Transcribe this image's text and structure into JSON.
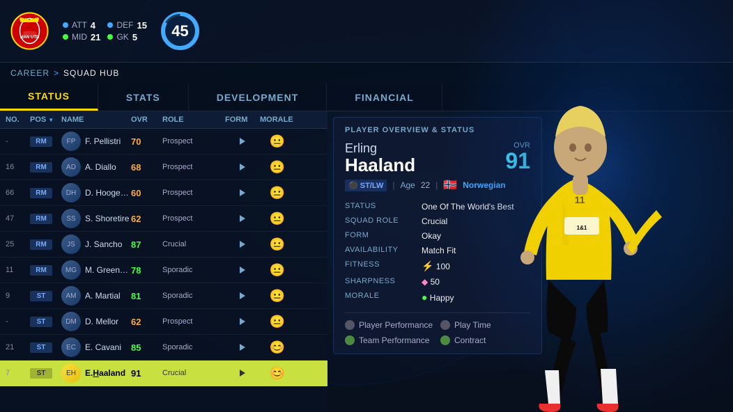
{
  "background": {
    "color": "#0a1628"
  },
  "topbar": {
    "stats": [
      {
        "key": "ATT",
        "val": "4",
        "color": "blue"
      },
      {
        "key": "DEF",
        "val": "15",
        "color": "blue"
      },
      {
        "key": "MID",
        "val": "21",
        "color": "green"
      },
      {
        "key": "GK",
        "val": "5",
        "color": "green"
      }
    ],
    "overall": "45"
  },
  "breadcrumb": {
    "career": "CAREER",
    "sep": ">",
    "current": "SQUAD HUB"
  },
  "nav": {
    "tabs": [
      {
        "label": "STATUS",
        "active": true
      },
      {
        "label": "STATS",
        "active": false
      },
      {
        "label": "DEVELOPMENT",
        "active": false
      },
      {
        "label": "FINANCIAL",
        "active": false
      }
    ]
  },
  "table": {
    "headers": [
      "No.",
      "Pos",
      "Name",
      "OVR",
      "Role",
      "Form",
      "Morale"
    ],
    "rows": [
      {
        "no": "-",
        "pos": "RM",
        "name": "F. Pellistri",
        "ovr": "70",
        "ovr_color": "orange",
        "role": "Prospect",
        "highlighted": false,
        "special": true,
        "morale": "neutral"
      },
      {
        "no": "16",
        "pos": "RM",
        "name": "A. Diallo",
        "ovr": "68",
        "ovr_color": "orange",
        "role": "Prospect",
        "highlighted": false,
        "special": false,
        "morale": "neutral"
      },
      {
        "no": "66",
        "pos": "RM",
        "name": "D. Hoogewerf",
        "ovr": "60",
        "ovr_color": "orange",
        "role": "Prospect",
        "highlighted": false,
        "special": false,
        "morale": "neutral"
      },
      {
        "no": "47",
        "pos": "RM",
        "name": "S. Shoretire",
        "ovr": "62",
        "ovr_color": "orange",
        "role": "Prospect",
        "highlighted": false,
        "special": false,
        "morale": "neutral"
      },
      {
        "no": "25",
        "pos": "RM",
        "name": "J. Sancho",
        "ovr": "87",
        "ovr_color": "green",
        "role": "Crucial",
        "highlighted": false,
        "special": false,
        "morale": "neutral"
      },
      {
        "no": "11",
        "pos": "RM",
        "name": "M. Greenwood",
        "ovr": "78",
        "ovr_color": "green",
        "role": "Sporadic",
        "highlighted": false,
        "special": false,
        "morale": "neutral"
      },
      {
        "no": "9",
        "pos": "ST",
        "name": "A. Martial",
        "ovr": "81",
        "ovr_color": "green",
        "role": "Sporadic",
        "highlighted": false,
        "special": false,
        "morale": "neutral"
      },
      {
        "no": "-",
        "pos": "ST",
        "name": "D. Mellor",
        "ovr": "62",
        "ovr_color": "orange",
        "role": "Prospect",
        "highlighted": false,
        "special": true,
        "morale": "neutral"
      },
      {
        "no": "21",
        "pos": "ST",
        "name": "E. Cavani",
        "ovr": "85",
        "ovr_color": "green",
        "role": "Sporadic",
        "highlighted": false,
        "special": false,
        "morale": "happy"
      },
      {
        "no": "7",
        "pos": "ST",
        "name": "E.Haaland",
        "ovr": "91",
        "ovr_color": "teal",
        "role": "Crucial",
        "highlighted": true,
        "special": false,
        "morale": "happy",
        "name_highlight": "H"
      }
    ]
  },
  "overview": {
    "panel_title": "PLAYER OVERVIEW & STATUS",
    "first_name": "Erling",
    "last_name": "Haaland",
    "ovr_label": "OVR",
    "ovr_value": "91",
    "meta": {
      "position": "ST/LW",
      "age_label": "Age",
      "age": "22",
      "nationality": "Norwegian",
      "flag": "🇳🇴"
    },
    "stats": [
      {
        "key": "STATUS",
        "val": "One Of The World's Best"
      },
      {
        "key": "SQUAD ROLE",
        "val": "Crucial"
      },
      {
        "key": "FORM",
        "val": "Okay"
      },
      {
        "key": "AVAILABILITY",
        "val": "Match Fit"
      },
      {
        "key": "FITNESS",
        "val": "⚡ 100",
        "icon": "lightning"
      },
      {
        "key": "SHARPNESS",
        "val": "💎 50",
        "icon": "diamond"
      },
      {
        "key": "MORALE",
        "val": "🟢 Happy",
        "icon": "circle"
      }
    ],
    "footer": [
      {
        "label": "Player Performance",
        "green": false
      },
      {
        "label": "Play Time",
        "green": false
      },
      {
        "label": "Team Performance",
        "green": true
      },
      {
        "label": "Contract",
        "green": true
      }
    ]
  }
}
